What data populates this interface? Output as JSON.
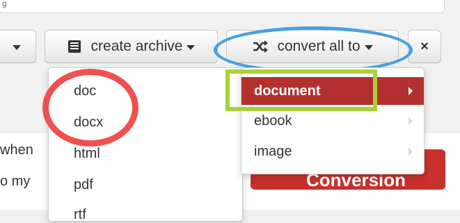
{
  "top_text": "g",
  "toolbar": {
    "left_caret": "",
    "archive_label": "create archive",
    "convert_label": "convert all to",
    "close_label": "×"
  },
  "format_menu": {
    "items": [
      "doc",
      "docx",
      "html",
      "pdf",
      "rtf"
    ]
  },
  "category_menu": {
    "items": [
      {
        "label": "document",
        "active": true
      },
      {
        "label": "ebook",
        "active": false
      },
      {
        "label": "image",
        "active": false
      }
    ]
  },
  "background": {
    "side_text_1": "when",
    "side_text_2": "o my",
    "start_label": "Start Conversion"
  },
  "highlights": {
    "blue": "#4a9fe0",
    "red": "#f05050",
    "green": "#a8d13a",
    "active_menu": "#b2312e"
  }
}
